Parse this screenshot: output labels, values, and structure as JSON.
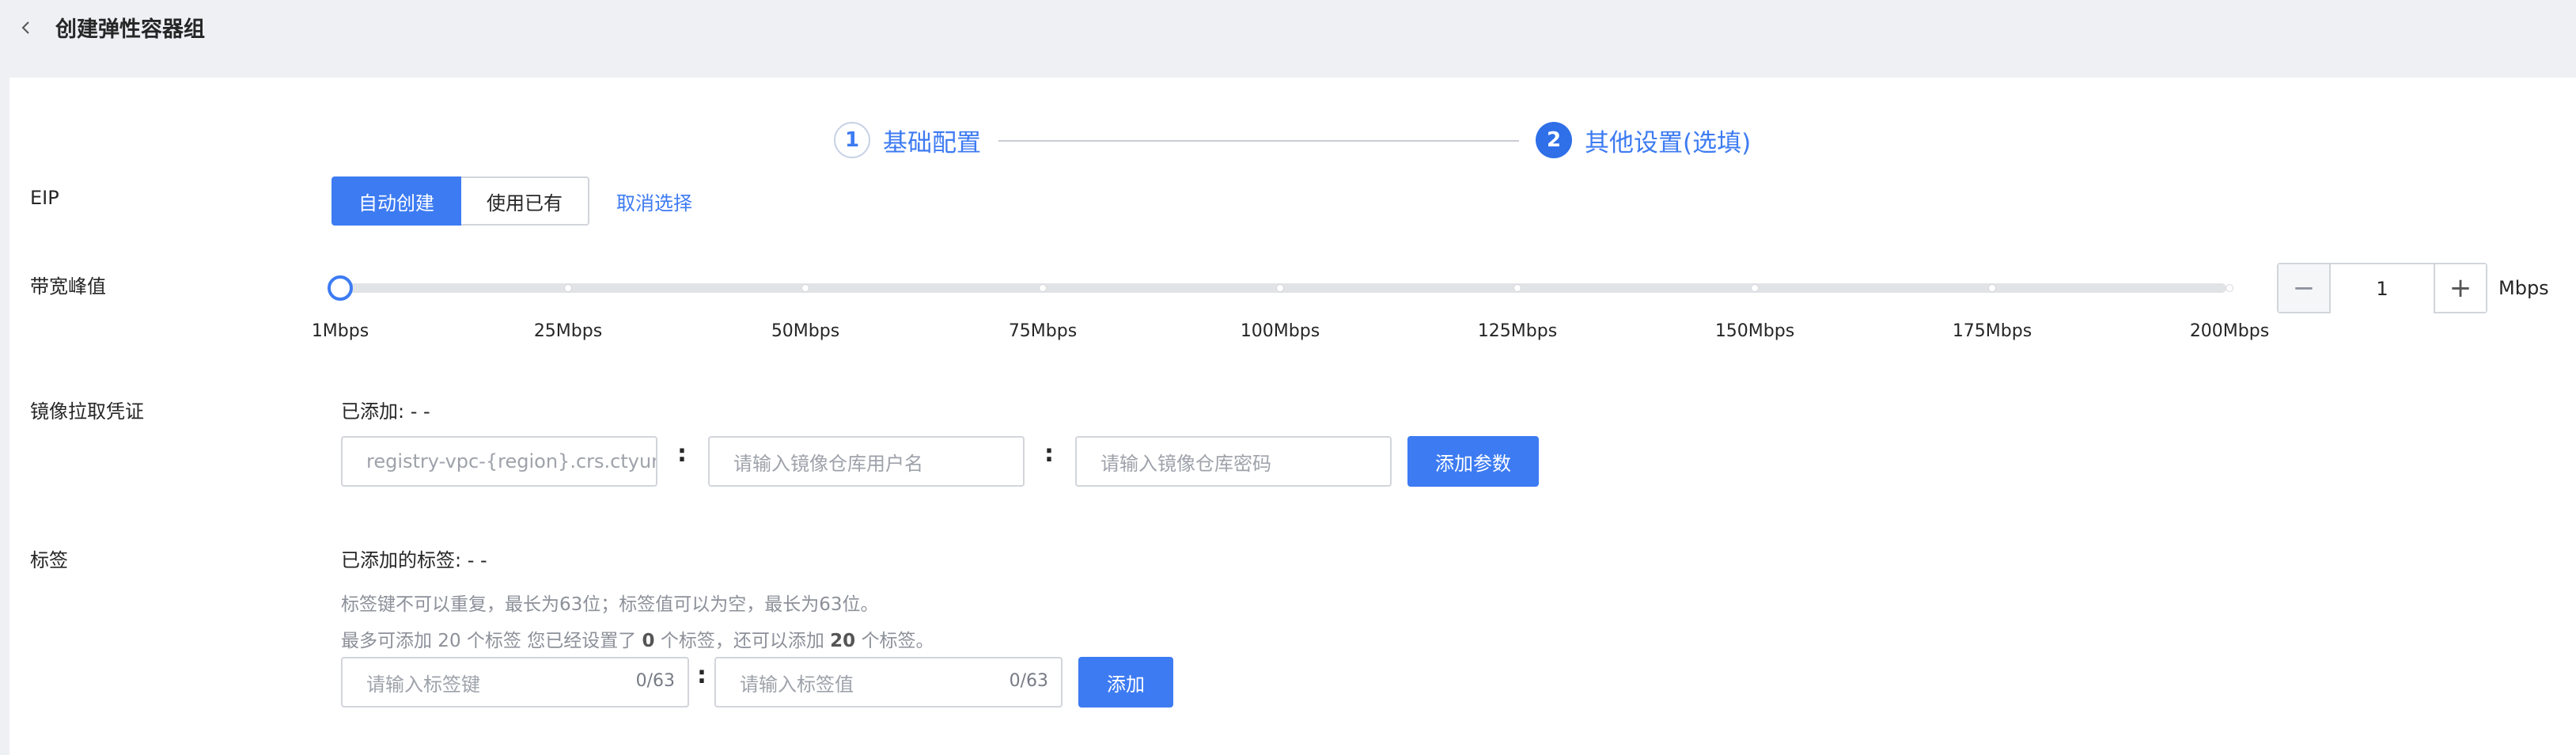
{
  "header": {
    "title": "创建弹性容器组"
  },
  "steps": [
    {
      "number": "1",
      "label": "基础配置"
    },
    {
      "number": "2",
      "label": "其他设置(选填)"
    }
  ],
  "eip": {
    "label": "EIP",
    "options": [
      "自动创建",
      "使用已有"
    ],
    "selected": "自动创建",
    "cancel_link": "取消选择"
  },
  "bandwidth": {
    "label": "带宽峰值",
    "ticks": [
      "1Mbps",
      "25Mbps",
      "50Mbps",
      "75Mbps",
      "100Mbps",
      "125Mbps",
      "150Mbps",
      "175Mbps",
      "200Mbps"
    ],
    "value": "1",
    "minus": "−",
    "plus": "+",
    "unit": "Mbps"
  },
  "registry": {
    "label": "镜像拉取凭证",
    "added_text": "已添加: - -",
    "address_placeholder": "registry-vpc-{region}.crs.ctyun.cn",
    "username_placeholder": "请输入镜像仓库用户名",
    "password_placeholder": "请输入镜像仓库密码",
    "colon": ":",
    "add_button": "添加参数"
  },
  "tags": {
    "label": "标签",
    "added_text": "已添加的标签: - -",
    "hint1": "标签键不可以重复，最长为63位；标签值可以为空，最长为63位。",
    "hint2_prefix": "最多可添加 20 个标签 您已经设置了 ",
    "hint2_count_set": "0",
    "hint2_middle": " 个标签，还可以添加 ",
    "hint2_count_left": "20",
    "hint2_suffix": " 个标签。",
    "key_placeholder": "请输入标签键",
    "value_placeholder": "请输入标签值",
    "key_counter": "0/63",
    "value_counter": "0/63",
    "colon": ":",
    "add_button": "添加"
  }
}
